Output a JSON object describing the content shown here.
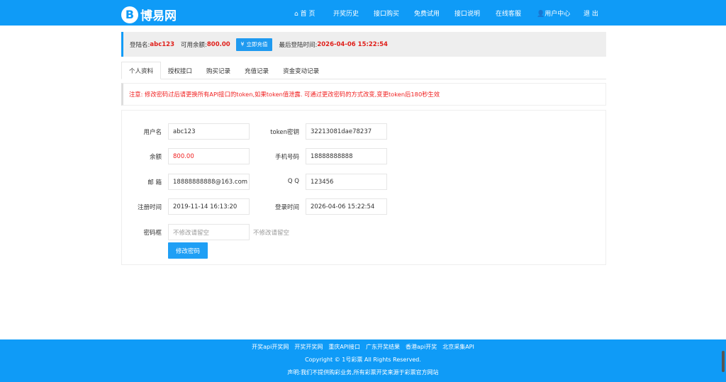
{
  "header": {
    "logo_text": "博易网",
    "logo_letter": "B",
    "nav": [
      "首 页",
      "开奖历史",
      "接口购买",
      "免费试用",
      "接口说明",
      "在线客服",
      "用户中心",
      "退 出"
    ]
  },
  "info": {
    "login_label": "登陆名:",
    "login_value": "abc123",
    "balance_label": "可用余额:",
    "balance_value": "800.00",
    "recharge_label": "立即充值",
    "last_login_label": "最后登陆时间:",
    "last_login_value": "2026-04-06 15:22:54"
  },
  "tabs": [
    "个人资料",
    "授权接口",
    "购买记录",
    "充值记录",
    "资金变动记录"
  ],
  "notice": "注意: 修改密码过后请更换所有API接口的token,如果token值泄露. 可通过更改密码的方式改变,变更token后180秒生效",
  "form": {
    "username": {
      "label": "用户名",
      "value": "abc123"
    },
    "token": {
      "label": "token密钥",
      "value": "32213081dae78237"
    },
    "balance": {
      "label": "余额",
      "value": "800.00"
    },
    "phone": {
      "label": "手机号码",
      "value": "18888888888"
    },
    "email": {
      "label": "邮 箱",
      "value": "18888888888@163.com"
    },
    "qq": {
      "label": "Q Q",
      "value": "123456"
    },
    "reg_time": {
      "label": "注册时间",
      "value": "2019-11-14 16:13:20"
    },
    "login_time": {
      "label": "登录时间",
      "value": "2026-04-06 15:22:54"
    },
    "password": {
      "label": "密码框",
      "placeholder": "不修改请留空",
      "hint": "不修改请留空"
    },
    "submit": "修改密码"
  },
  "footer": {
    "links": [
      "开奖api开奖网",
      "开奖开奖网",
      "重庆API接口",
      "广东开奖结果",
      "香港api开奖",
      "北京采集API"
    ],
    "copyright": "Copyright © 1号彩票 All Rights Reserved.",
    "disclaimer": "声明:我们不提供购彩业务,所有彩票开奖来源于彩票官方网站"
  },
  "colors": {
    "brand": "#0f9bf7",
    "alert": "#e0201b"
  }
}
